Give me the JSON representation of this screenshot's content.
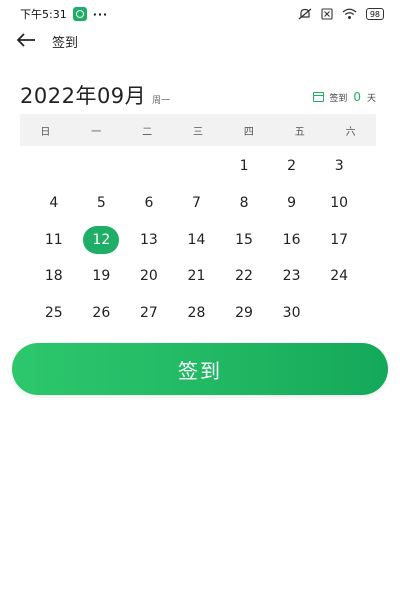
{
  "status_bar": {
    "time": "下午5:31",
    "more": "···",
    "battery": "98",
    "icons": [
      "notifications-off-icon",
      "sim-off-icon",
      "wifi-icon",
      "battery-icon"
    ]
  },
  "header": {
    "back_icon": "arrow-left-icon",
    "title": "签到"
  },
  "calendar": {
    "month_label": "2022年09月",
    "weekday_label": "周一",
    "checkin_label": "签到",
    "checkin_count": "0",
    "checkin_unit": "天",
    "weekdays": [
      "日",
      "一",
      "二",
      "三",
      "四",
      "五",
      "六"
    ],
    "days": [
      "",
      "",
      "",
      "",
      "1",
      "2",
      "3",
      "4",
      "5",
      "6",
      "7",
      "8",
      "9",
      "10",
      "11",
      "12",
      "13",
      "14",
      "15",
      "16",
      "17",
      "18",
      "19",
      "20",
      "21",
      "22",
      "23",
      "24",
      "25",
      "26",
      "27",
      "28",
      "29",
      "30",
      ""
    ],
    "selected_day": "12"
  },
  "checkin_button": {
    "label": "签到"
  },
  "colors": {
    "accent": "#1fae66",
    "button_start": "#2dc76d",
    "button_end": "#14a85a",
    "weekday_bg": "#f2f2f2"
  }
}
